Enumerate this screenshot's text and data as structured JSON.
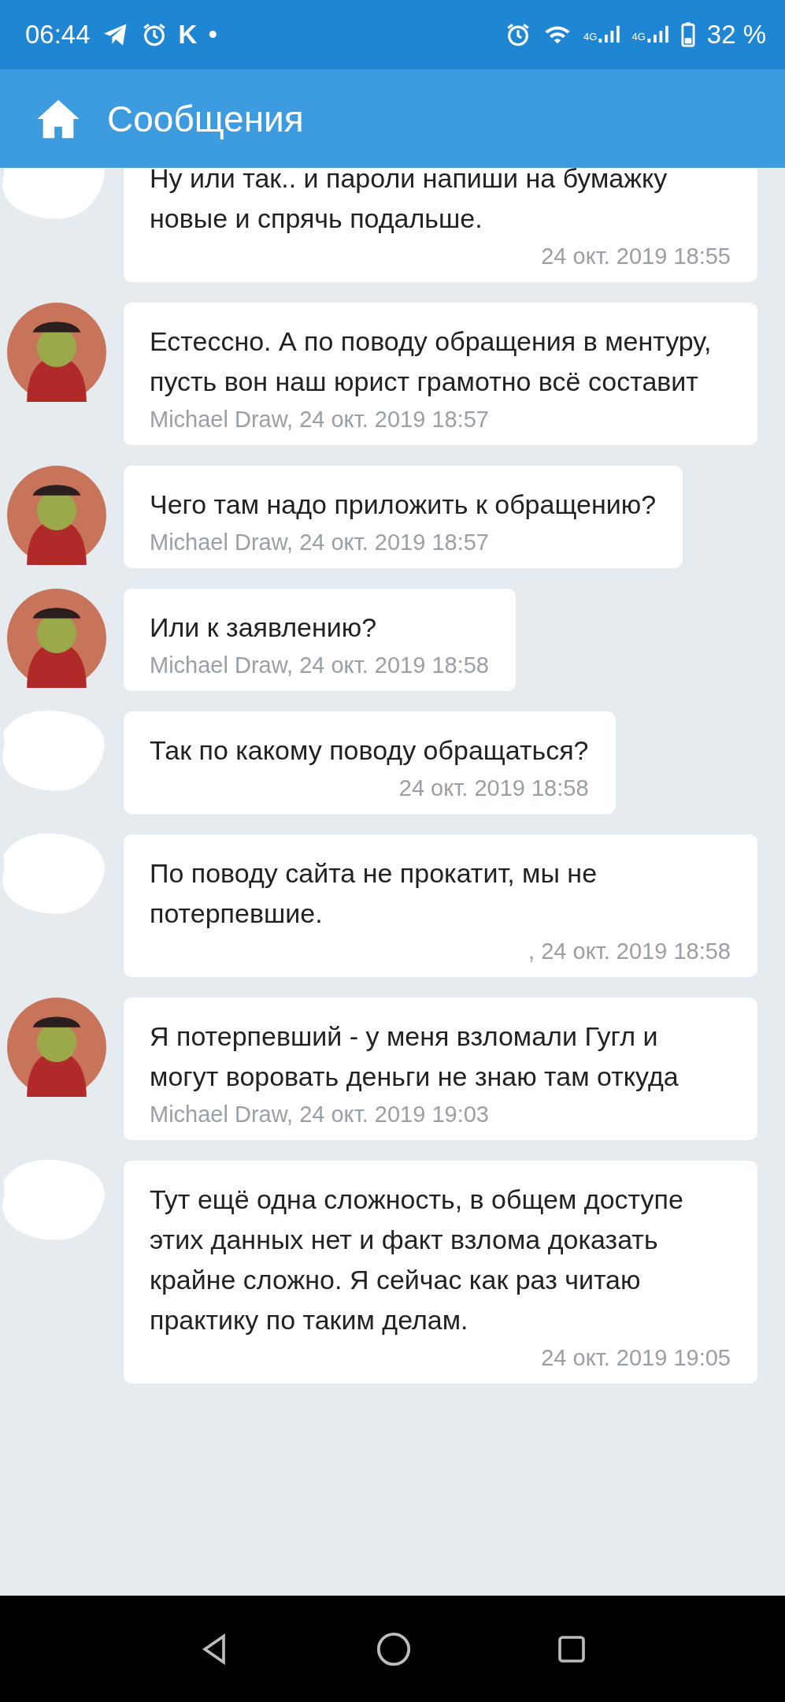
{
  "status_bar": {
    "time": "06:44",
    "app_letter": "K",
    "dot": "•",
    "network_1": "4G",
    "network_2": "4G",
    "battery": "32 %"
  },
  "header": {
    "title": "Сообщения"
  },
  "messages": [
    {
      "kind": "redacted",
      "text": "Ну или так.. и пароли напиши на бумажку новые и спрячь подальше.",
      "meta": "24 окт. 2019 18:55"
    },
    {
      "kind": "peer",
      "text": "Естессно. А по поводу обращения в ментуру, пусть вон наш юрист грамотно всё составит",
      "meta": "Michael Draw, 24 окт. 2019 18:57"
    },
    {
      "kind": "peer",
      "text": "Чего там надо приложить к обращению?",
      "meta": "Michael Draw, 24 окт. 2019 18:57"
    },
    {
      "kind": "peer",
      "text": "Или к заявлению?",
      "meta": "Michael Draw, 24 окт. 2019 18:58"
    },
    {
      "kind": "redacted",
      "text": "Так по какому поводу обращаться?",
      "meta": "24 окт. 2019 18:58"
    },
    {
      "kind": "redacted",
      "text": "По поводу сайта не прокатит, мы не потерпевшие.",
      "meta": ", 24 окт. 2019 18:58"
    },
    {
      "kind": "peer",
      "text": "Я потерпевший - у меня взломали Гугл и могут воровать деньги не знаю там откуда",
      "meta": "Michael Draw, 24 окт. 2019 19:03"
    },
    {
      "kind": "redacted",
      "text": "Тут ещё одна сложность, в общем доступе этих данных нет и факт взлома доказать крайне сложно. Я сейчас как раз читаю практику по таким делам.",
      "meta": "24 окт. 2019 19:05"
    }
  ]
}
